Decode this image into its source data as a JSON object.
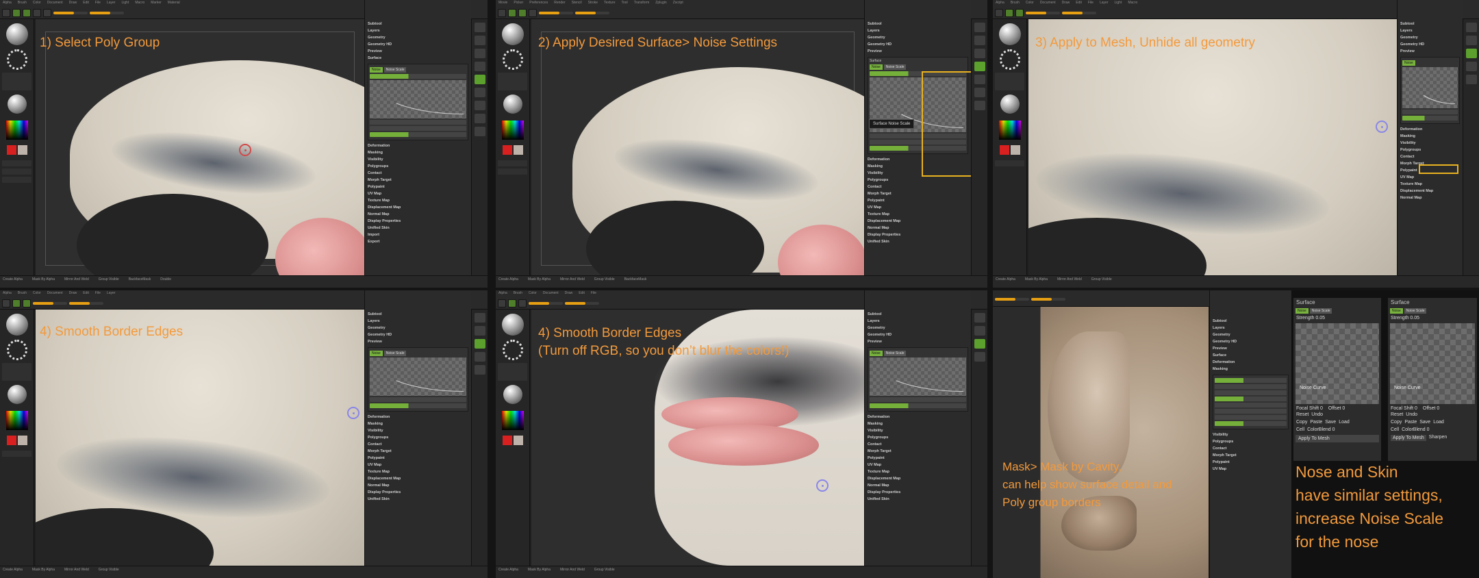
{
  "menu": [
    "Alpha",
    "Brush",
    "Color",
    "Document",
    "Draw",
    "Edit",
    "File",
    "Layer",
    "Light",
    "Macro",
    "Marker",
    "Material",
    "Movie",
    "Picker",
    "Preferences",
    "Render",
    "Stencil",
    "Stroke",
    "Texture",
    "Tool",
    "Transform",
    "Zplugin",
    "Zscript"
  ],
  "tray_items": [
    "Subtool",
    "Layers",
    "Geometry",
    "Geometry HD",
    "Preview",
    "Surface",
    "Deformation",
    "Masking",
    "Visibility",
    "Polygroups",
    "Contact",
    "Morph Target",
    "Polypaint",
    "UV Map",
    "Texture Map",
    "Displacement Map",
    "Normal Map",
    "Display Properties",
    "Unified Skin",
    "Import",
    "Export"
  ],
  "surface": {
    "header": "Surface",
    "noise_button": "Noise",
    "noise_scale": "Noise Scale",
    "strength": "Strength 0.05",
    "noise_curve": "Noise Curve",
    "focal_shift": "Focal Shift 0",
    "offset": "Offset 0",
    "colorblend": "ColorBlend 0",
    "apply_to_mesh": "Apply To Mesh",
    "reset": "Reset",
    "undo": "Undo",
    "copy": "Copy",
    "paste": "Paste",
    "save": "Save",
    "load": "Load",
    "cell": "Cell",
    "sharpen": "Sharpen"
  },
  "tooltip": "Surface Noise Scale",
  "bottom_items": [
    "Create Alpha",
    "Mask By Alpha",
    "Mirror And Weld",
    "Group Visible",
    "BackfaceMask",
    "Double"
  ],
  "captions": {
    "p1": "1) Select Poly Group",
    "p2": "2) Apply Desired Surface> Noise Settings",
    "p3": "3) Apply to Mesh, Unhide all geometry",
    "p4": "4) Smooth Border Edges",
    "p5a": "4) Smooth Border Edges",
    "p5b": "(Turn off RGB, so you don’t blur the colors!)",
    "p6a": "Mask> Mask by Cavity,",
    "p6b": "can help show surface detail and",
    "p6c": "Poly group borders",
    "p7a": "Nose and Skin",
    "p7b": "have similar settings,",
    "p7c": "increase Noise Scale",
    "p7d": "for the nose"
  },
  "colors": {
    "accent": "#f39a3c",
    "highlight": "#e9b321",
    "green": "#78b33e",
    "cursor": "#8a86e8"
  }
}
